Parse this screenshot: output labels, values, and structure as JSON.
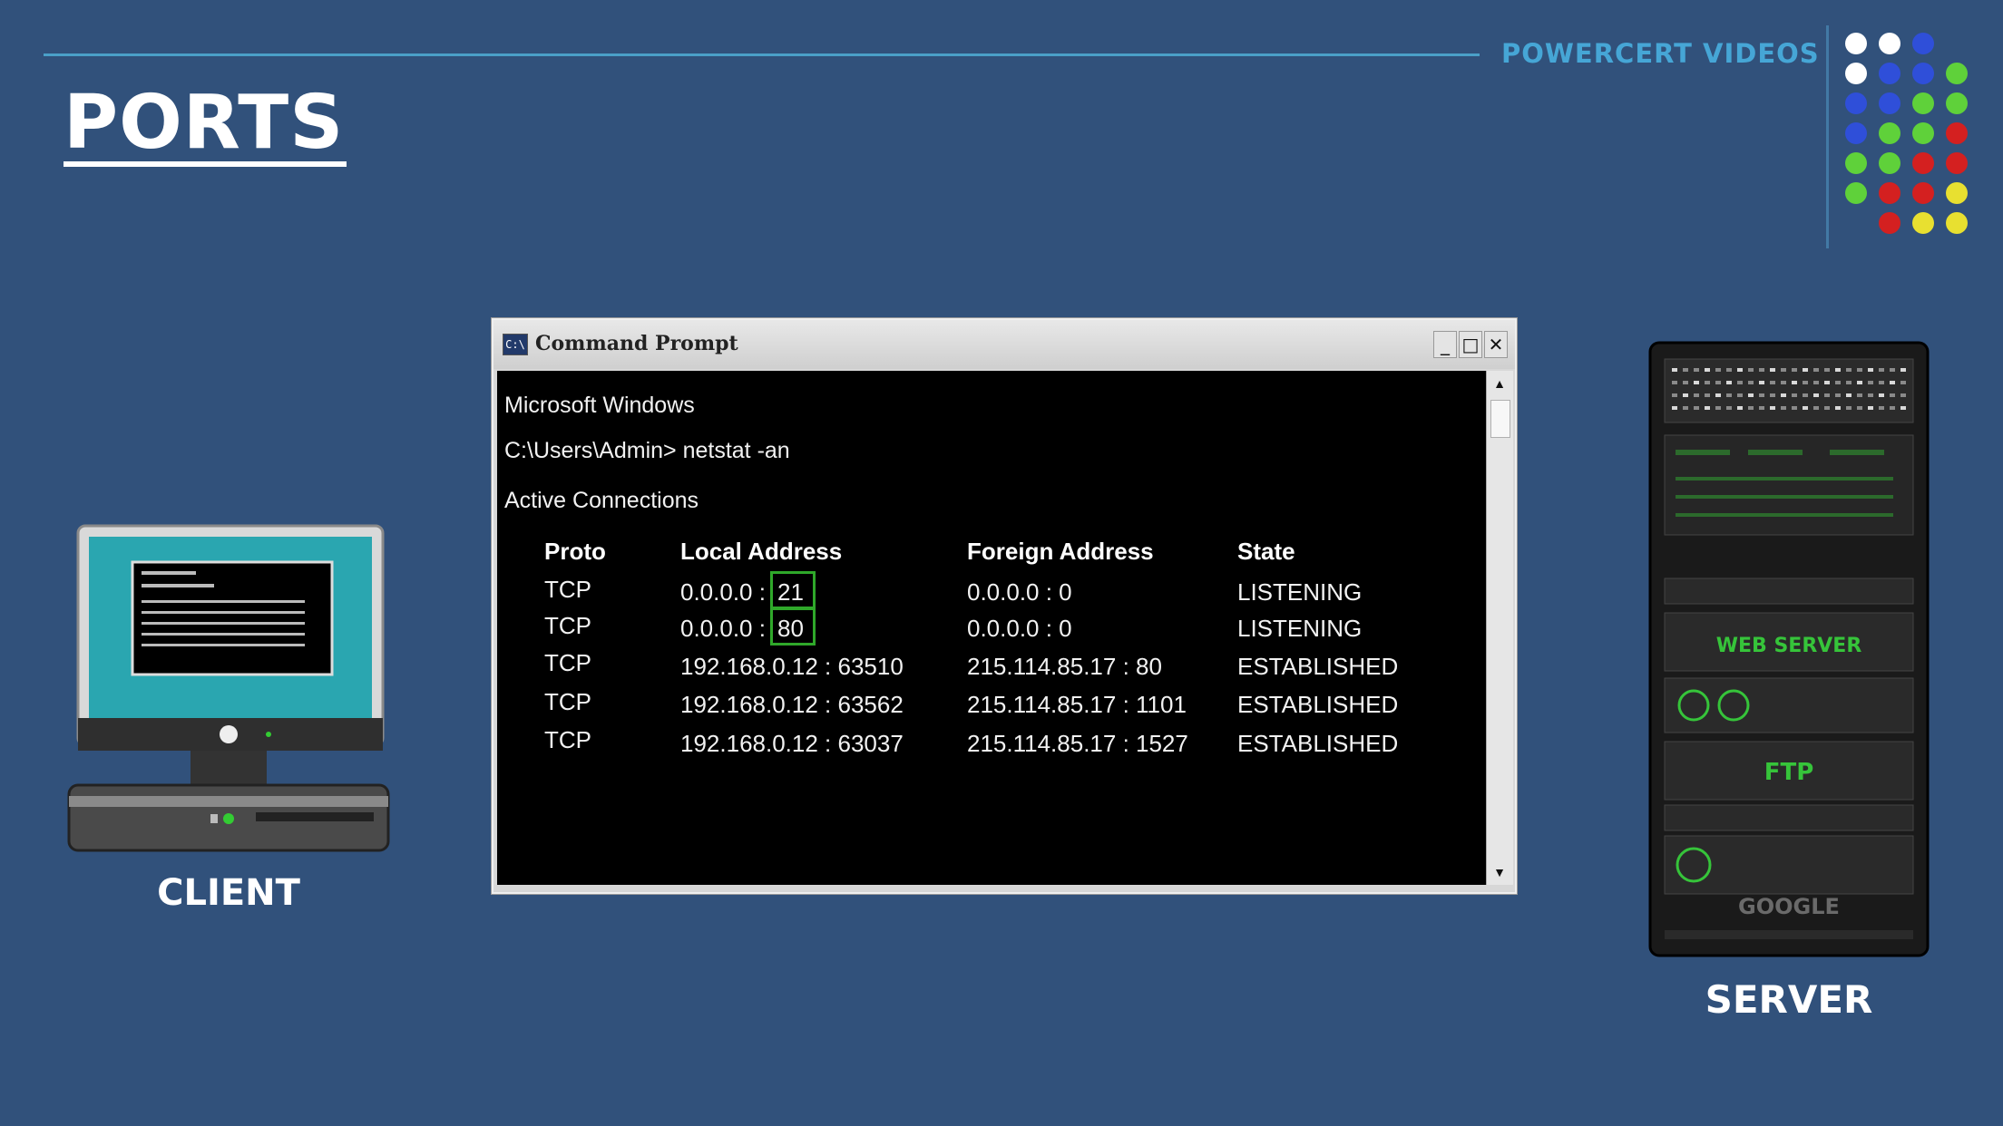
{
  "brand": "POWERCERT VIDEOS",
  "page_title": "PORTS",
  "client_label": "CLIENT",
  "server_label": "SERVER",
  "server_panels": [
    "WEB SERVER",
    "FTP",
    "GOOGLE"
  ],
  "window": {
    "title": "Command Prompt",
    "icon_text": "C:\\",
    "buttons": {
      "minimize": "_",
      "maximize": "□",
      "close": "✕"
    }
  },
  "console": {
    "line1": "Microsoft Windows",
    "prompt": "C:\\Users\\Admin> netstat -an",
    "section": "Active Connections",
    "headers": [
      "Proto",
      "Local Address",
      "Foreign Address",
      "State"
    ],
    "rows": [
      {
        "proto": "TCP",
        "local_ip": "0.0.0.0 :",
        "local_port": "21",
        "foreign": "0.0.0.0 : 0",
        "state": "LISTENING"
      },
      {
        "proto": "TCP",
        "local_ip": "0.0.0.0 :",
        "local_port": "80",
        "foreign": "0.0.0.0 : 0",
        "state": "LISTENING"
      },
      {
        "proto": "TCP",
        "local": "192.168.0.12 : 63510",
        "foreign": "215.114.85.17 : 80",
        "state": "ESTABLISHED"
      },
      {
        "proto": "TCP",
        "local": "192.168.0.12 : 63562",
        "foreign": "215.114.85.17 : 1101",
        "state": "ESTABLISHED"
      },
      {
        "proto": "TCP",
        "local": "192.168.0.12 : 63037",
        "foreign": "215.114.85.17 : 1527",
        "state": "ESTABLISHED"
      }
    ]
  },
  "colors": {
    "background": "#31517b",
    "brand": "#46a6d6",
    "highlight_box": "#2fa82a",
    "dots": [
      "#ffffff",
      "#2f4fd9",
      "#5fd13a",
      "#d42020",
      "#e8e030"
    ]
  }
}
